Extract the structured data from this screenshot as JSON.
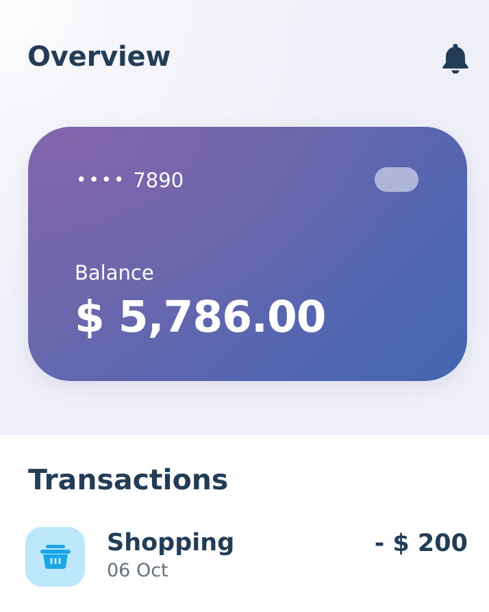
{
  "header": {
    "title": "Overview",
    "notification_icon": "bell-icon"
  },
  "card": {
    "masked_dots": "••••",
    "last_four": "7890",
    "balance_label": "Balance",
    "balance_amount": "$ 5,786.00",
    "colors": {
      "gradient_start": "#7b67ae",
      "gradient_end": "#4466b2"
    }
  },
  "transactions": {
    "title": "Transactions",
    "items": [
      {
        "name": "Shopping",
        "date": "06 Oct",
        "amount": "- $ 200",
        "icon": "shopping-basket-icon",
        "icon_bg": "#bde8fb",
        "icon_color": "#1aa6e6"
      }
    ]
  },
  "colors": {
    "text_dark": "#233d56",
    "background": "#efeff8"
  }
}
